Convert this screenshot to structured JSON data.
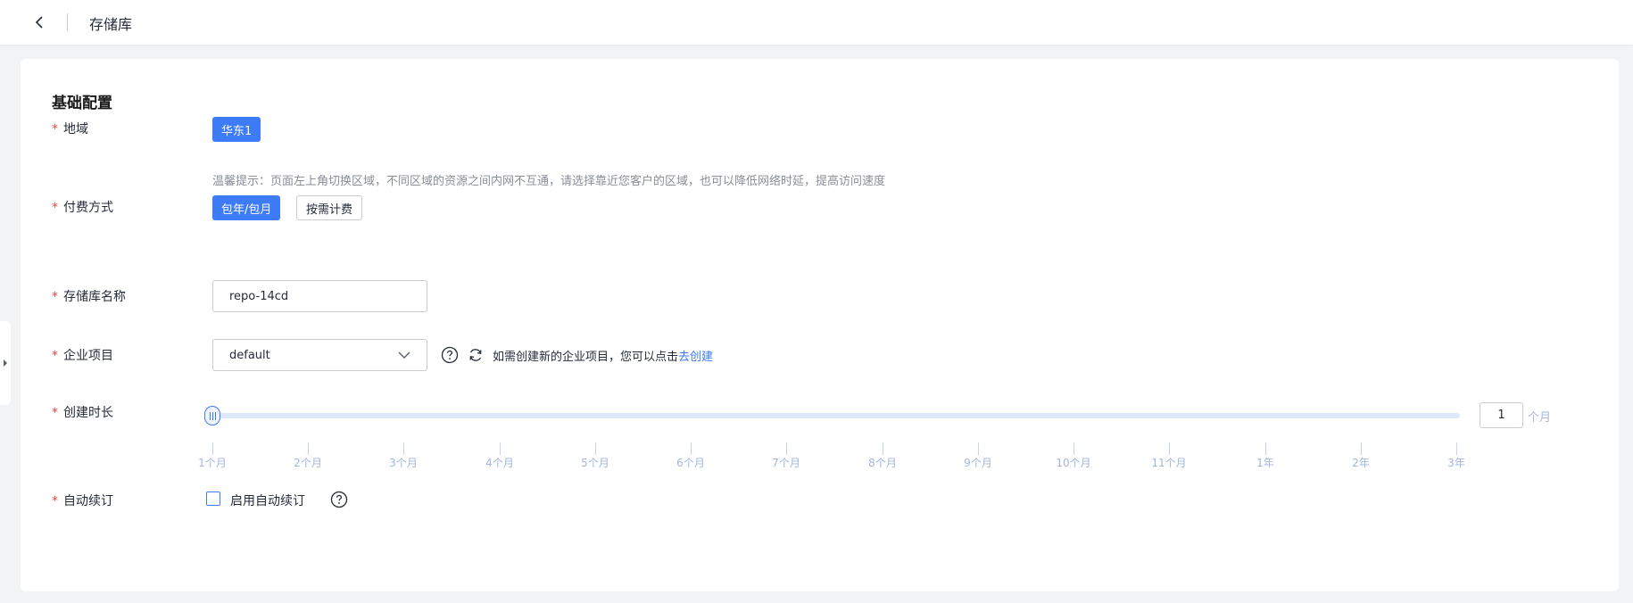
{
  "header": {
    "title": "存储库"
  },
  "section": {
    "title": "基础配置"
  },
  "region": {
    "label": "地域",
    "selected": "华东1",
    "hint": "温馨提示：页面左上角切换区域，不同区域的资源之间内网不互通，请选择靠近您客户的区域，也可以降低网络时延，提高访问速度"
  },
  "billing": {
    "label": "付费方式",
    "options": [
      "包年/包月",
      "按需计费"
    ],
    "selected": "包年/包月"
  },
  "repo_name": {
    "label": "存储库名称",
    "value": "repo-14cd"
  },
  "project": {
    "label": "企业项目",
    "value": "default",
    "hint": "如需创建新的企业项目，您可以点击",
    "link": "去创建"
  },
  "duration": {
    "label": "创建时长",
    "ticks": [
      "1个月",
      "2个月",
      "3个月",
      "4个月",
      "5个月",
      "6个月",
      "7个月",
      "8个月",
      "9个月",
      "10个月",
      "11个月",
      "1年",
      "2年",
      "3年"
    ],
    "value": "1",
    "unit": "个月"
  },
  "auto_renew": {
    "label": "自动续订",
    "checkbox_label": "启用自动续订",
    "checked": false
  },
  "colors": {
    "primary": "#3e7cf7",
    "required": "#e54545",
    "hint": "#8a8e99"
  }
}
